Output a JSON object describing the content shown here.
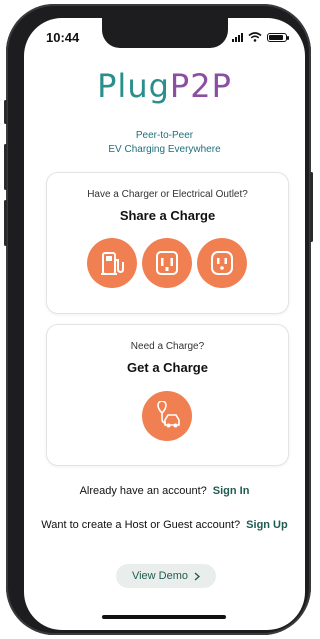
{
  "status_bar": {
    "time": "10:44"
  },
  "logo": {
    "part1": "Pl",
    "part2": "ug",
    "part3": "P2P"
  },
  "tagline": {
    "line1": "Peer-to-Peer",
    "line2": "EV Charging Everywhere"
  },
  "share_card": {
    "subtitle": "Have a Charger or Electrical Outlet?",
    "title": "Share a Charge",
    "icons": [
      "ev-charger-station-icon",
      "nema-outlet-icon",
      "wall-outlet-icon"
    ]
  },
  "get_card": {
    "subtitle": "Need a Charge?",
    "title": "Get a Charge",
    "icons": [
      "car-charging-location-icon"
    ]
  },
  "sign_in_row": {
    "text": "Already have an account?",
    "link": "Sign In"
  },
  "sign_up_row": {
    "text": "Want to create a Host or Guest account?",
    "link": "Sign Up"
  },
  "demo_button": {
    "label": "View Demo"
  },
  "colors": {
    "accent": "#f08052",
    "brand_teal": "#2a8f8a",
    "brand_purple": "#8a4fa3",
    "link": "#1f5c50"
  }
}
